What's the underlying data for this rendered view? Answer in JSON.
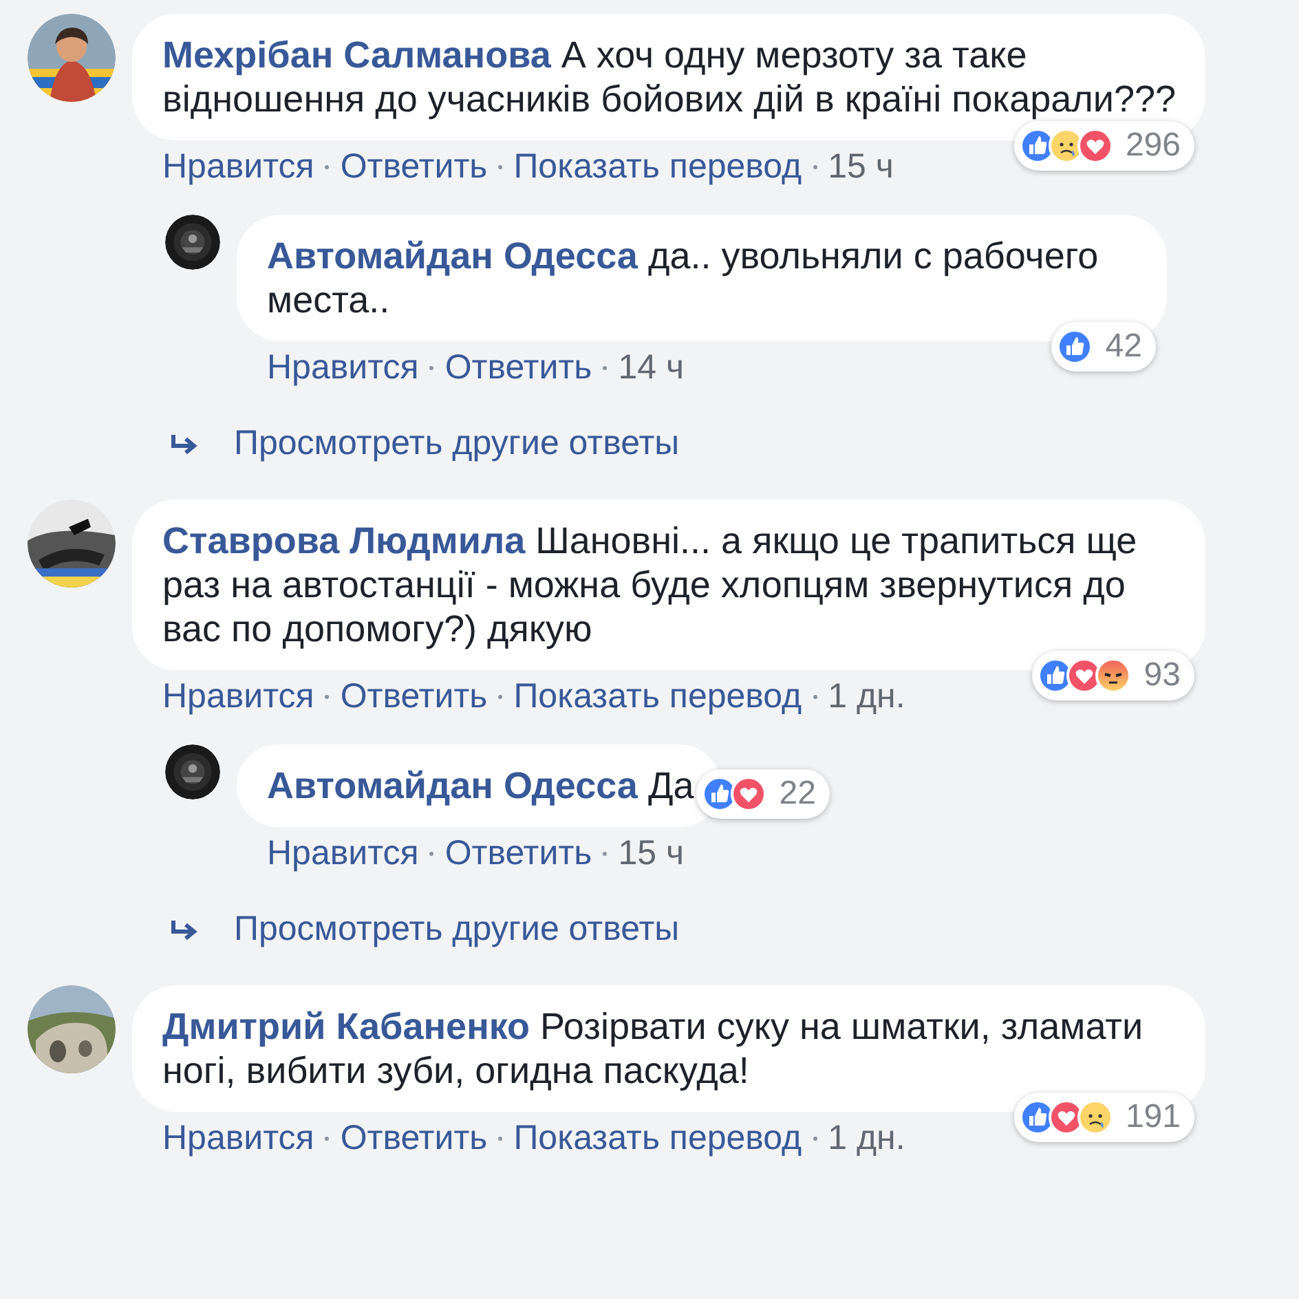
{
  "comments": [
    {
      "author": "Мехрібан Салманова",
      "text": "А хоч одну мерзоту за таке відношення до учасників бойових дій в країні покарали???",
      "reactions": [
        {
          "kind": "like"
        },
        {
          "kind": "sad"
        },
        {
          "kind": "love"
        }
      ],
      "reaction_count": "296",
      "actions": [
        "Нравится",
        "Ответить",
        "Показать перевод"
      ],
      "time": "15 ч",
      "replies": [
        {
          "author": "Автомайдан Одесса",
          "text": "да.. увольняли с рабочего места..",
          "reactions": [
            {
              "kind": "like"
            }
          ],
          "reaction_count": "42",
          "actions": [
            "Нравится",
            "Ответить"
          ],
          "time": "14 ч"
        }
      ],
      "more_replies": "Просмотреть другие ответы"
    },
    {
      "author": "Ставрова Людмила",
      "text": "Шановні... а якщо це трапиться ще раз на автостанції - можна буде хлопцям звернутися до вас по допомогу?) дякую",
      "reactions": [
        {
          "kind": "like"
        },
        {
          "kind": "love"
        },
        {
          "kind": "angry"
        }
      ],
      "reaction_count": "93",
      "actions": [
        "Нравится",
        "Ответить",
        "Показать перевод"
      ],
      "time": "1 дн.",
      "replies": [
        {
          "author": "Автомайдан Одесса",
          "text": "Да",
          "reactions": [
            {
              "kind": "like"
            },
            {
              "kind": "love"
            }
          ],
          "reaction_count": "22",
          "actions": [
            "Нравится",
            "Ответить"
          ],
          "time": "15 ч"
        }
      ],
      "more_replies": "Просмотреть другие ответы"
    },
    {
      "author": "Дмитрий Кабаненко",
      "text": "Розірвати суку на шматки, зламати ногі, вибити зуби, огидна паскуда!",
      "reactions": [
        {
          "kind": "like"
        },
        {
          "kind": "love"
        },
        {
          "kind": "sad"
        }
      ],
      "reaction_count": "191",
      "actions": [
        "Нравится",
        "Ответить",
        "Показать перевод"
      ],
      "time": "1 дн."
    }
  ]
}
